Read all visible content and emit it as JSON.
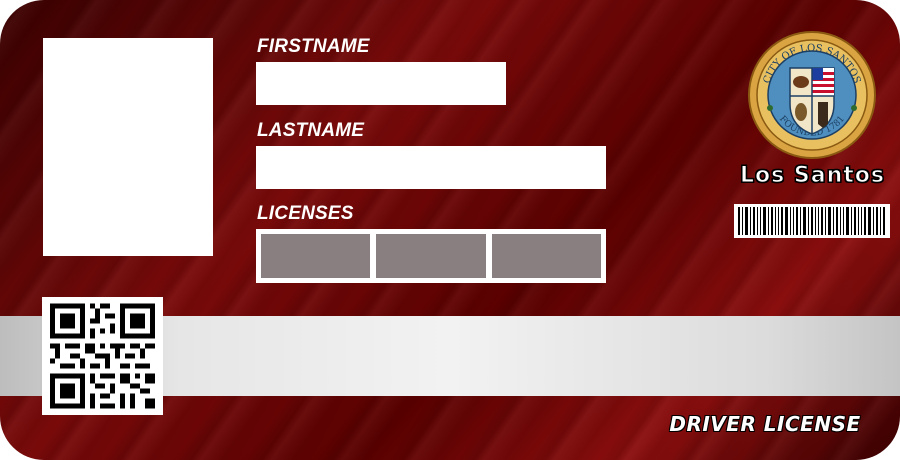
{
  "card": {
    "fields": {
      "firstname_label": "FIRSTNAME",
      "firstname_value": "",
      "lastname_label": "LASTNAME",
      "lastname_value": "",
      "licenses_label": "LICENSES",
      "license_slots": 3
    },
    "seal": {
      "top_text": "CITY OF LOS SANTOS",
      "bottom_text": "FOUNDED 1781"
    },
    "city_name": "Los Santos",
    "document_type": "DRIVER LICENSE",
    "colors": {
      "card_base": "#6b0505",
      "field_bg": "#ffffff",
      "license_slot": "#8a7f80",
      "band": "#e6e6e6",
      "seal_ring": "#d9a441",
      "seal_inner": "#4f8fbf"
    },
    "icons": [
      "photo-placeholder",
      "qr-code",
      "city-seal",
      "barcode"
    ]
  }
}
